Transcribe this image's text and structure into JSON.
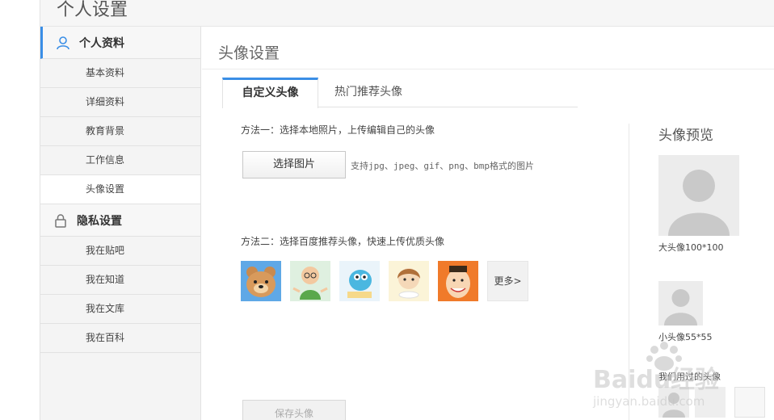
{
  "header": {
    "title": "个人设置"
  },
  "sidebar": {
    "sections": [
      {
        "label": "个人资料",
        "icon": "user-icon",
        "items": [
          "基本资料",
          "详细资料",
          "教育背景",
          "工作信息",
          "头像设置"
        ]
      },
      {
        "label": "隐私设置",
        "icon": "lock-icon",
        "items": [
          "我在贴吧",
          "我在知道",
          "我在文库",
          "我在百科"
        ]
      }
    ],
    "current_item": "头像设置"
  },
  "main": {
    "title": "头像设置",
    "tabs": [
      {
        "label": "自定义头像",
        "active": true
      },
      {
        "label": "热门推荐头像",
        "active": false
      }
    ],
    "method1": {
      "text": "方法一：选择本地照片，上传编辑自己的头像",
      "button": "选择图片",
      "hint": "支持jpg、jpeg、gif、png、bmp格式的图片"
    },
    "method2": {
      "text": "方法二：选择百度推荐头像，快速上传优质头像",
      "avatars": [
        "bear-avatar",
        "green-man-avatar",
        "blue-creature-avatar",
        "girl-avatar",
        "orange-man-avatar"
      ],
      "more": "更多>"
    },
    "save_button": "保存头像"
  },
  "preview": {
    "title": "头像预览",
    "big_caption": "大头像100*100",
    "small_caption": "小头像55*55",
    "recent_caption": "我们用过的头像"
  },
  "watermark": {
    "brand": "Baidu经验",
    "domain": "jingyan.baidu.com"
  },
  "colors": {
    "accent": "#3a8ee6",
    "placeholder": "#ececec",
    "silhouette": "#c9c9c9"
  }
}
